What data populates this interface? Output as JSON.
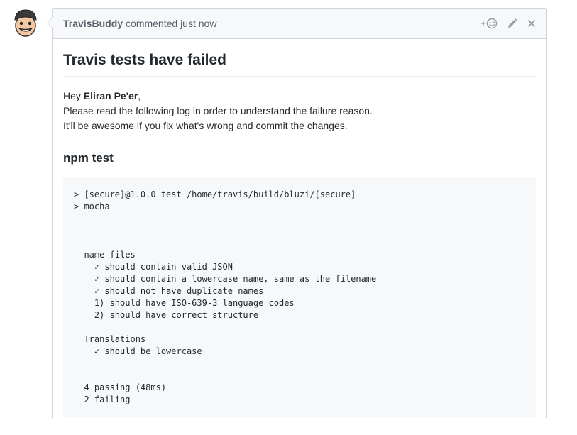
{
  "comment": {
    "author": "TravisBuddy",
    "action": "commented just now",
    "title": "Travis tests have failed",
    "greeting_prefix": "Hey ",
    "recipient": "Eliran Pe'er",
    "greeting_suffix": ",",
    "line2": "Please read the following log in order to understand the failure reason.",
    "line3": "It'll be awesome if you fix what's wrong and commit the changes.",
    "section_title": "npm test",
    "log": "> [secure]@1.0.0 test /home/travis/build/bluzi/[secure]\n> mocha\n\n\n\n  name files\n    ✓ should contain valid JSON\n    ✓ should contain a lowercase name, same as the filename\n    ✓ should not have duplicate names\n    1) should have ISO-639-3 language codes\n    2) should have correct structure\n\n  Translations\n    ✓ should be lowercase\n\n\n  4 passing (48ms)\n  2 failing"
  },
  "icons": {
    "reaction": "smiley-add-icon",
    "edit": "pencil-icon",
    "close": "close-icon",
    "avatar": "avatar"
  }
}
